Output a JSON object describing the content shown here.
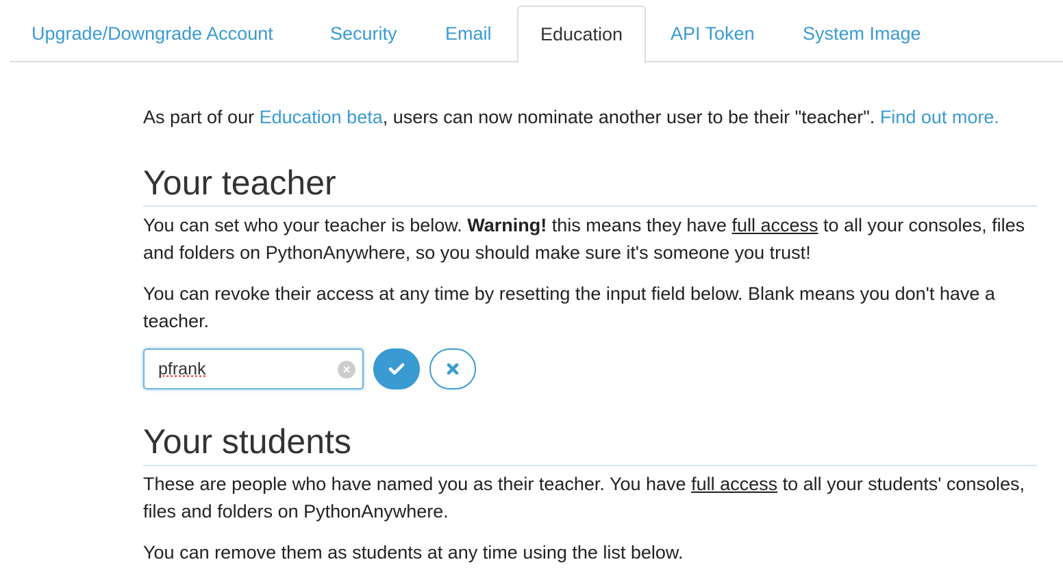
{
  "tabs": [
    {
      "label": "Upgrade/Downgrade Account",
      "active": false
    },
    {
      "label": "Security",
      "active": false
    },
    {
      "label": "Email",
      "active": false
    },
    {
      "label": "Education",
      "active": true
    },
    {
      "label": "API Token",
      "active": false
    },
    {
      "label": "System Image",
      "active": false
    }
  ],
  "intro": {
    "prefix": "As part of our ",
    "link1": "Education beta",
    "middle": ", users can now nominate another user to be their \"teacher\". ",
    "link2": "Find out more."
  },
  "teacher": {
    "heading": "Your teacher",
    "para1_a": "You can set who your teacher is below. ",
    "para1_warning": "Warning!",
    "para1_b": " this means they have ",
    "para1_access": "full access",
    "para1_c": " to all your consoles, files and folders on PythonAnywhere, so you should make sure it's someone you trust!",
    "para2": "You can revoke their access at any time by resetting the input field below. Blank means you don't have a teacher.",
    "input_value": "pfrank",
    "clear_icon": "clear-circle-icon",
    "confirm_icon": "checkmark-icon",
    "cancel_icon": "x-icon"
  },
  "students": {
    "heading": "Your students",
    "para1_a": "These are people who have named you as their teacher. You have ",
    "para1_access": "full access",
    "para1_b": " to all your students' consoles, files and folders on PythonAnywhere.",
    "para2": "You can remove them as students at any time using the list below."
  },
  "colors": {
    "accent": "#3a9bd2",
    "heading_rule": "#cfe6f4",
    "tab_border": "#dddddd"
  }
}
